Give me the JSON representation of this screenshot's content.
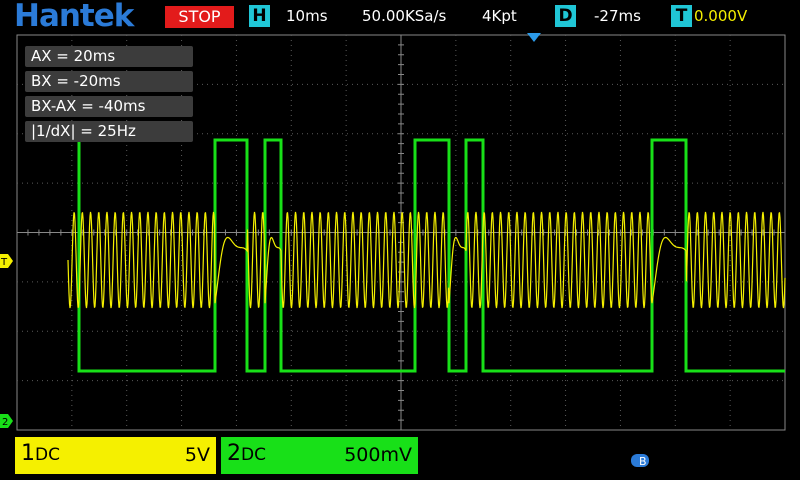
{
  "header": {
    "brand": "Hantek",
    "run_state": "STOP",
    "timebase_badge": "H",
    "timebase": "10ms",
    "sample_rate": "50.00KSa/s",
    "memory_depth": "4Kpt",
    "delay_badge": "D",
    "delay": "-27ms",
    "trigger_badge": "T",
    "trigger_level": "0.000V"
  },
  "cursors": {
    "rows": [
      {
        "label": "AX      = 20ms"
      },
      {
        "label": "BX      = -20ms"
      },
      {
        "label": "BX-AX = -40ms"
      },
      {
        "label": "|1/dX|   = 25Hz"
      }
    ]
  },
  "markers": {
    "trigger_marker": "T",
    "ch2_marker": "2"
  },
  "channels": [
    {
      "number": "1",
      "coupling": "DC",
      "scale": "5V",
      "color": "#f5f000"
    },
    {
      "number": "2",
      "coupling": "DC",
      "scale": "500mV",
      "color": "#18e018"
    }
  ],
  "status": {
    "lock_label": "B"
  },
  "colors": {
    "ch1": "#f5f000",
    "ch2": "#18e018",
    "brand": "#2b7bd8",
    "stop": "#e31b1b",
    "badge": "#20c6d6"
  }
}
